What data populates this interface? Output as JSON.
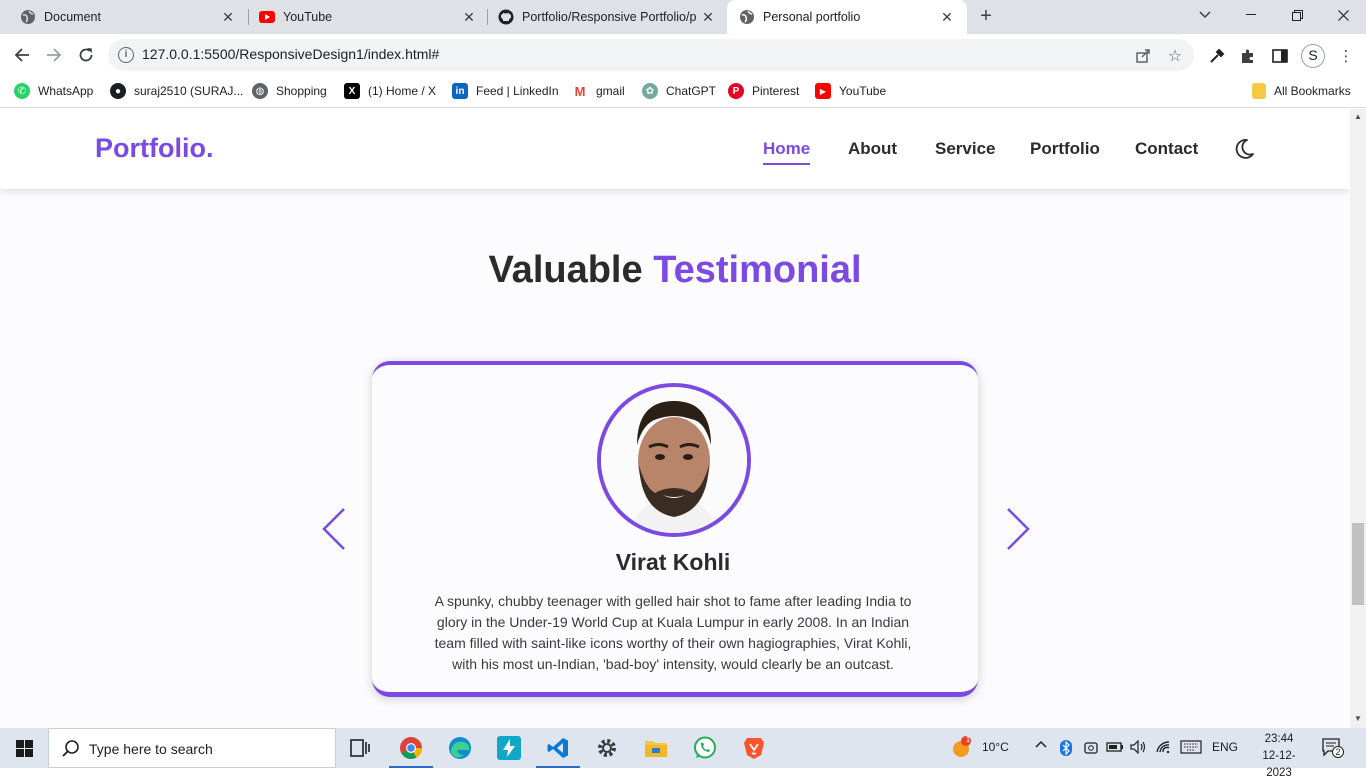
{
  "browser": {
    "tabs": [
      {
        "title": "Document",
        "icon": "globe-icon"
      },
      {
        "title": "YouTube",
        "icon": "youtube-icon"
      },
      {
        "title": "Portfolio/Responsive Portfolio/p",
        "icon": "github-icon"
      },
      {
        "title": "Personal portfolio",
        "icon": "globe-icon",
        "active": true
      }
    ],
    "url": "127.0.0.1:5500/ResponsiveDesign1/index.html#",
    "profile_initial": "S",
    "bookmarks": [
      {
        "label": "WhatsApp",
        "icon": "whatsapp-icon",
        "color": "#25d366"
      },
      {
        "label": "suraj2510 (SURAJ...",
        "icon": "github-icon",
        "color": "#1b1f23"
      },
      {
        "label": "Shopping",
        "icon": "globe-icon",
        "color": "#5f6368"
      },
      {
        "label": "(1) Home / X",
        "icon": "x-icon",
        "color": "#000000"
      },
      {
        "label": "Feed | LinkedIn",
        "icon": "linkedin-icon",
        "color": "#0a66c2"
      },
      {
        "label": "gmail",
        "icon": "gmail-icon",
        "color": "#ea4335"
      },
      {
        "label": "ChatGPT",
        "icon": "chatgpt-icon",
        "color": "#74aa9c"
      },
      {
        "label": "Pinterest",
        "icon": "pinterest-icon",
        "color": "#e60023"
      },
      {
        "label": "YouTube",
        "icon": "youtube-icon",
        "color": "#ff0000"
      }
    ],
    "all_bookmarks": "All Bookmarks"
  },
  "site": {
    "logo": "Portfolio.",
    "nav": [
      "Home",
      "About",
      "Service",
      "Portfolio",
      "Contact"
    ],
    "active_nav": "Home",
    "accent_color": "#7b4ae2",
    "section_title": {
      "part1": "Valuable",
      "part2": "Testimonial"
    },
    "testimonial": {
      "name": "Virat Kohli",
      "text": "A spunky, chubby teenager with gelled hair shot to fame after leading India to glory in the Under-19 World Cup at Kuala Lumpur in early 2008. In an Indian team filled with saint-like icons worthy of their own hagiographies, Virat Kohli, with his most un-Indian, 'bad-boy' intensity, would clearly be an outcast."
    }
  },
  "taskbar": {
    "search_placeholder": "Type here to search",
    "weather": "10°C",
    "weather_badge": "1",
    "language": "ENG",
    "time": "23:44",
    "date": "12-12-2023",
    "notification_count": "2"
  }
}
